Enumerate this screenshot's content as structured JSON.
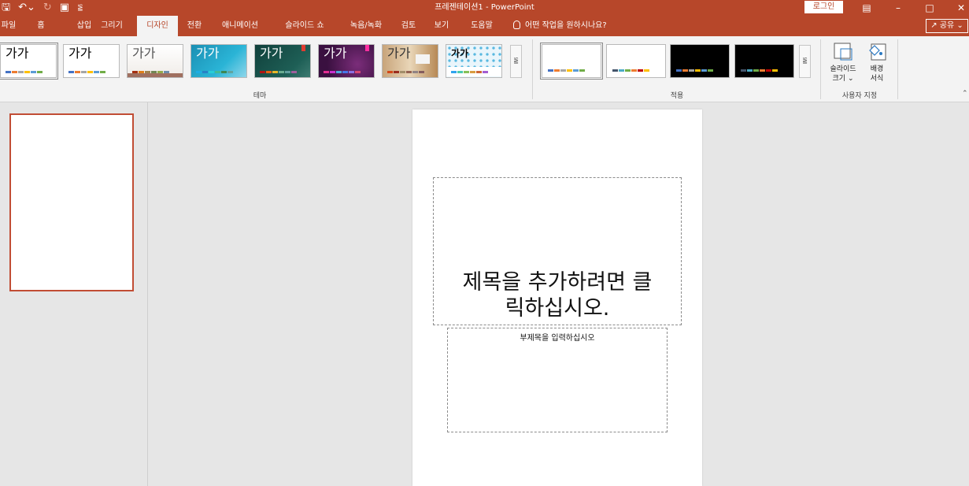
{
  "window": {
    "title": "프레젠테이션1 - PowerPoint",
    "login_label": "로그인",
    "icons": [
      "save-icon",
      "undo-icon",
      "redo-icon",
      "present-icon",
      "customize-qat-icon",
      "ribbon-display-icon",
      "minimize-icon",
      "maximize-icon",
      "close-icon"
    ]
  },
  "tabs": [
    {
      "label": "파일"
    },
    {
      "label": "홈"
    },
    {
      "label": "삽입"
    },
    {
      "label": "그리기"
    },
    {
      "label": "디자인",
      "active": true
    },
    {
      "label": "전환"
    },
    {
      "label": "애니메이션"
    },
    {
      "label": "슬라이드 쇼"
    },
    {
      "label": "녹음/녹화"
    },
    {
      "label": "검토"
    },
    {
      "label": "보기"
    },
    {
      "label": "도움말"
    }
  ],
  "tell_me": "어떤 작업을 원하시나요?",
  "share_label": "공유",
  "ribbon": {
    "themes_group_label": "테마",
    "variants_group_label": "적용",
    "customize_group_label": "사용자 지정",
    "themes": [
      {
        "text": "가가"
      },
      {
        "text": "가가"
      },
      {
        "text": "가가"
      },
      {
        "text": "가가"
      },
      {
        "text": "가가"
      },
      {
        "text": "가가"
      },
      {
        "text": "가가"
      },
      {
        "text": "가가"
      }
    ],
    "slide_size_label_1": "슬라이드",
    "slide_size_label_2": "크기",
    "format_bg_label_1": "배경",
    "format_bg_label_2": "서식"
  },
  "slide": {
    "title_placeholder_line1": "제목을 추가하려면 클",
    "title_placeholder_line2": "릭하십시오.",
    "subtitle_placeholder": "부제목을 입력하십시오"
  },
  "colors": {
    "accent": "#b7472a",
    "ribbon_bg": "#f3f3f3",
    "workspace_bg": "#e6e6e6"
  }
}
